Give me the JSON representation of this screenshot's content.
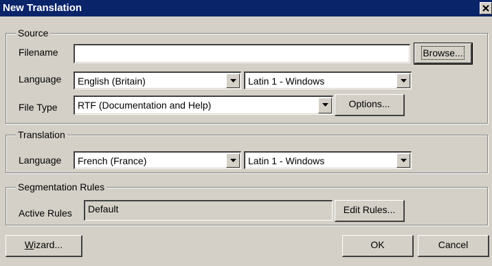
{
  "window": {
    "title": "New Translation"
  },
  "source": {
    "legend": "Source",
    "filename_label": "Filename",
    "filename_value": "",
    "browse_label": "Browse...",
    "language_label": "Language",
    "language_value": "English (Britain)",
    "encoding_value": "Latin 1 - Windows",
    "filetype_label": "File Type",
    "filetype_value": "RTF (Documentation and Help)",
    "options_label": "Options..."
  },
  "translation": {
    "legend": "Translation",
    "language_label": "Language",
    "language_value": "French (France)",
    "encoding_value": "Latin 1 - Windows"
  },
  "segmentation": {
    "legend": "Segmentation Rules",
    "active_rules_label": "Active Rules",
    "active_rules_value": "Default",
    "edit_rules_label": "Edit Rules..."
  },
  "footer": {
    "wizard_mnemonic": "W",
    "wizard_rest": "izard...",
    "ok_label": "OK",
    "cancel_label": "Cancel"
  },
  "icons": {
    "close": "close-icon",
    "dropdown": "chevron-down-icon"
  },
  "colors": {
    "titlebar": "#0a246a",
    "face": "#d4d0c8"
  }
}
